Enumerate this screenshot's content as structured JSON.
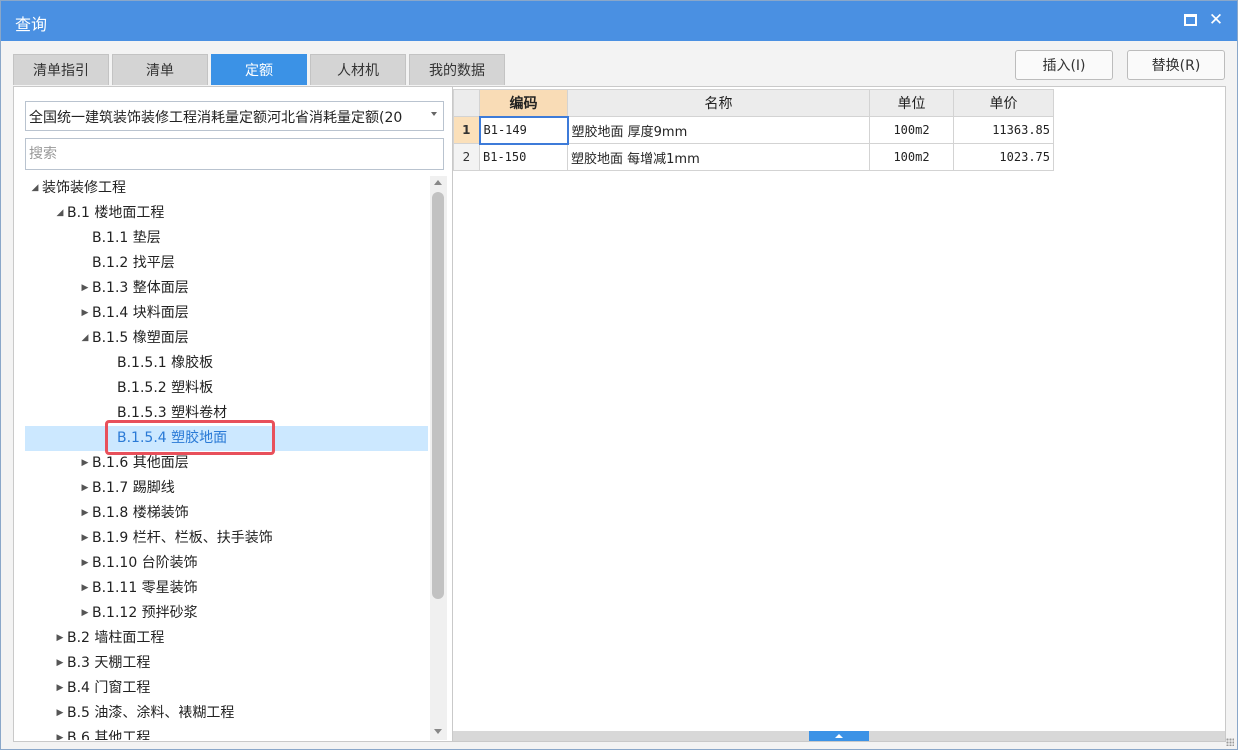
{
  "window": {
    "title": "查询"
  },
  "tabs": [
    {
      "label": "清单指引",
      "active": false
    },
    {
      "label": "清单",
      "active": false
    },
    {
      "label": "定额",
      "active": true
    },
    {
      "label": "人材机",
      "active": false
    },
    {
      "label": "我的数据",
      "active": false
    }
  ],
  "buttons": {
    "insert": "插入(I)",
    "replace": "替换(R)"
  },
  "quota_library": {
    "selected": "全国统一建筑装饰装修工程消耗量定额河北省消耗量定额(20"
  },
  "search": {
    "placeholder": "搜索",
    "value": ""
  },
  "tree": {
    "nodes": [
      {
        "label": "装饰装修工程",
        "level": 0,
        "toggle": "expanded"
      },
      {
        "label": "B.1 楼地面工程",
        "level": 1,
        "toggle": "expanded"
      },
      {
        "label": "B.1.1 垫层",
        "level": 2,
        "toggle": "none"
      },
      {
        "label": "B.1.2 找平层",
        "level": 2,
        "toggle": "none"
      },
      {
        "label": "B.1.3 整体面层",
        "level": 2,
        "toggle": "collapsed"
      },
      {
        "label": "B.1.4 块料面层",
        "level": 2,
        "toggle": "collapsed"
      },
      {
        "label": "B.1.5 橡塑面层",
        "level": 2,
        "toggle": "expanded"
      },
      {
        "label": "B.1.5.1 橡胶板",
        "level": 3,
        "toggle": "none"
      },
      {
        "label": "B.1.5.2 塑料板",
        "level": 3,
        "toggle": "none"
      },
      {
        "label": "B.1.5.3 塑料卷材",
        "level": 3,
        "toggle": "none"
      },
      {
        "label": "B.1.5.4 塑胶地面",
        "level": 3,
        "toggle": "none",
        "selected": true
      },
      {
        "label": "B.1.6 其他面层",
        "level": 2,
        "toggle": "collapsed"
      },
      {
        "label": "B.1.7 踢脚线",
        "level": 2,
        "toggle": "collapsed"
      },
      {
        "label": "B.1.8 楼梯装饰",
        "level": 2,
        "toggle": "collapsed"
      },
      {
        "label": "B.1.9 栏杆、栏板、扶手装饰",
        "level": 2,
        "toggle": "collapsed"
      },
      {
        "label": "B.1.10 台阶装饰",
        "level": 2,
        "toggle": "collapsed"
      },
      {
        "label": "B.1.11 零星装饰",
        "level": 2,
        "toggle": "collapsed"
      },
      {
        "label": "B.1.12 预拌砂浆",
        "level": 2,
        "toggle": "collapsed"
      },
      {
        "label": "B.2 墙柱面工程",
        "level": 1,
        "toggle": "collapsed"
      },
      {
        "label": "B.3 天棚工程",
        "level": 1,
        "toggle": "collapsed"
      },
      {
        "label": "B.4 门窗工程",
        "level": 1,
        "toggle": "collapsed"
      },
      {
        "label": "B.5 油漆、涂料、裱糊工程",
        "level": 1,
        "toggle": "collapsed"
      },
      {
        "label": "B.6 其他工程",
        "level": 1,
        "toggle": "collapsed"
      }
    ]
  },
  "table": {
    "columns": [
      "编码",
      "名称",
      "单位",
      "单价"
    ],
    "rows": [
      {
        "num": "1",
        "code": "B1-149",
        "name": "塑胶地面 厚度9mm",
        "unit": "100m2",
        "price": "11363.85",
        "current": true
      },
      {
        "num": "2",
        "code": "B1-150",
        "name": "塑胶地面 每增减1mm",
        "unit": "100m2",
        "price": "1023.75",
        "current": false
      }
    ]
  },
  "colors": {
    "titlebar": "#4a90e2",
    "active_tab": "#3b92e6",
    "selection": "#cce8ff",
    "highlight_box": "#e8505b",
    "code_header": "#f9dcb6"
  },
  "icons": {
    "maximize": "maximize-icon",
    "close": "close-icon",
    "tree_expanded": "triangle-down-right-icon",
    "tree_collapsed": "triangle-right-icon",
    "dropdown": "chevron-down-icon"
  }
}
